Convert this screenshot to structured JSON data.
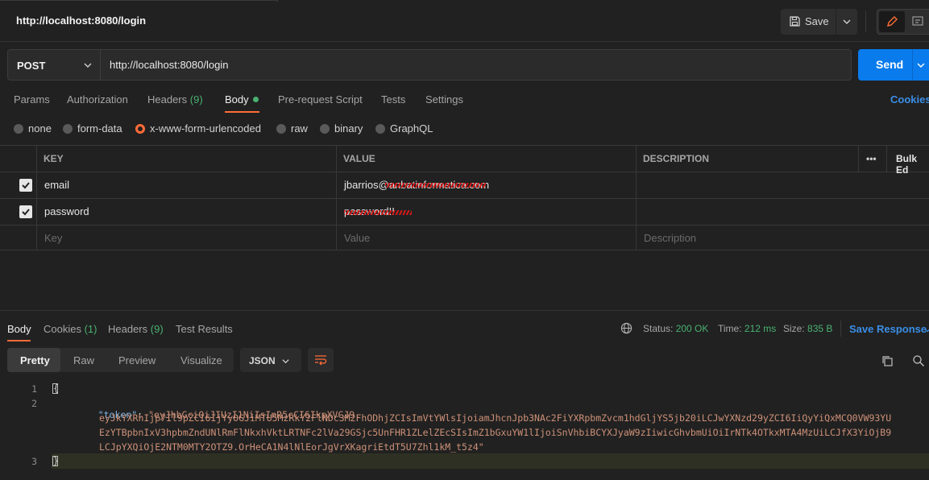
{
  "request": {
    "title": "http://localhost:8080/login",
    "save_label": "Save",
    "method": "POST",
    "url": "http://localhost:8080/login",
    "send_label": "Send"
  },
  "request_tabs": [
    {
      "label": "Params"
    },
    {
      "label": "Authorization"
    },
    {
      "label": "Headers",
      "count": "(9)"
    },
    {
      "label": "Body"
    },
    {
      "label": "Pre-request Script"
    },
    {
      "label": "Tests"
    },
    {
      "label": "Settings"
    }
  ],
  "cookies_link": "Cookies",
  "body_types": {
    "selected": "x-www-form-urlencoded",
    "options": [
      "none",
      "form-data",
      "x-www-form-urlencoded",
      "raw",
      "binary",
      "GraphQL"
    ]
  },
  "params_table": {
    "headers": {
      "key": "KEY",
      "value": "VALUE",
      "description": "DESCRIPTION",
      "more": "•••",
      "bulk": "Bulk Ed"
    },
    "rows": [
      {
        "key": "email",
        "value": "jbarrios@",
        "value_redacted": "anbatinformatica.com"
      },
      {
        "key": "password",
        "value": "",
        "value_redacted": "password!!"
      }
    ],
    "placeholder": {
      "key": "Key",
      "value": "Value",
      "description": "Description"
    }
  },
  "response_tabs": [
    {
      "label": "Body"
    },
    {
      "label": "Cookies",
      "count": "(1)"
    },
    {
      "label": "Headers",
      "count": "(9)"
    },
    {
      "label": "Test Results"
    }
  ],
  "status": {
    "status_label": "Status:",
    "status_value": "200 OK",
    "time_label": "Time:",
    "time_value": "212 ms",
    "size_label": "Size:",
    "size_value": "835 B"
  },
  "save_response": "Save Response",
  "view_modes": [
    "Pretty",
    "Raw",
    "Preview",
    "Visualize"
  ],
  "format": "JSON",
  "code": {
    "line_numbers": [
      "1",
      "2",
      "3"
    ],
    "token_key": "\"token\"",
    "token_lines": [
      "\"eyJhbGciOiJIUzI1NiIsInR5cCI6IkpXVCJ9.",
      "eyJkYXRhIjp7Il9pZCI6IjYyOGJiMTU5MzRkY2FlNDc3M2FhODhjZCIsImVtYWlsIjoiamJhcnJpb3NAc2FiYXRpbmZvcm1hdGljYS5jb20iLCJwYXNzd29yZCI6IiQyYiQxMCQ0VW93YU",
      "EzYTBpbnIxV3hpbmZndUNlRmFlNkxhVktLRTNFc2lVa29GSjc5UnFHR1ZLelZEcSIsImZ1bGxuYW1lIjoiSnVhbiBCYXJyaW9zIiwicGhvbmUiOiIrNTk4OTkxMTA4MzUiLCJfX3YiOjB9",
      "LCJpYXQiOjE2NTM0MTY2OTZ9.OrHeCA1N4lNlEorJgVrXKagriEtdT5U7Zhl1kM_t5z4\""
    ]
  }
}
